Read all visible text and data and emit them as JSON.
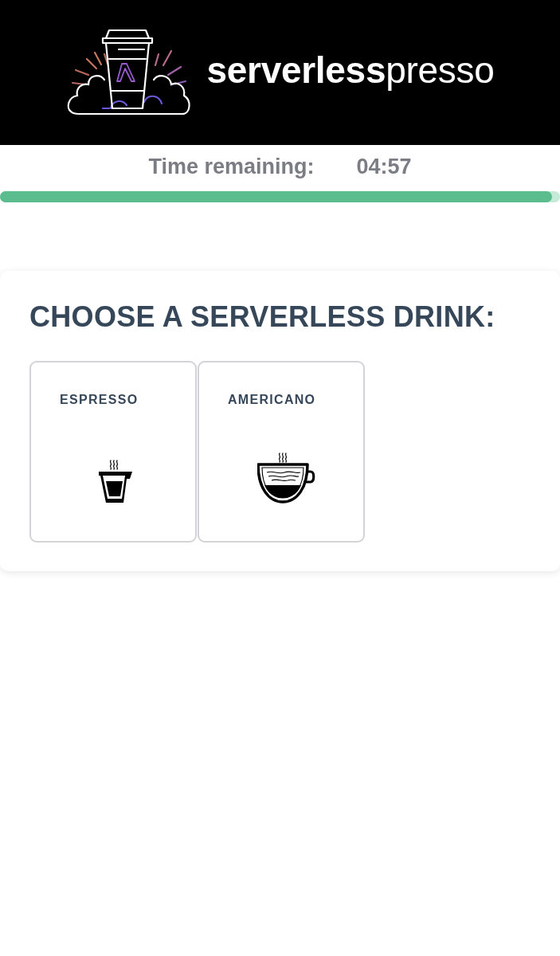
{
  "header": {
    "logo_text": "**serverless**presso"
  },
  "timer": {
    "label": "Time remaining:",
    "value": "04:57",
    "level": 0.986
  },
  "drink_panel": {
    "title": "CHOOSE A SERVERLESS DRINK:",
    "drinks": [
      {
        "name": "ESPRESSO",
        "kind": "espresso"
      },
      {
        "name": "AMERICANO",
        "kind": "americano"
      }
    ]
  }
}
